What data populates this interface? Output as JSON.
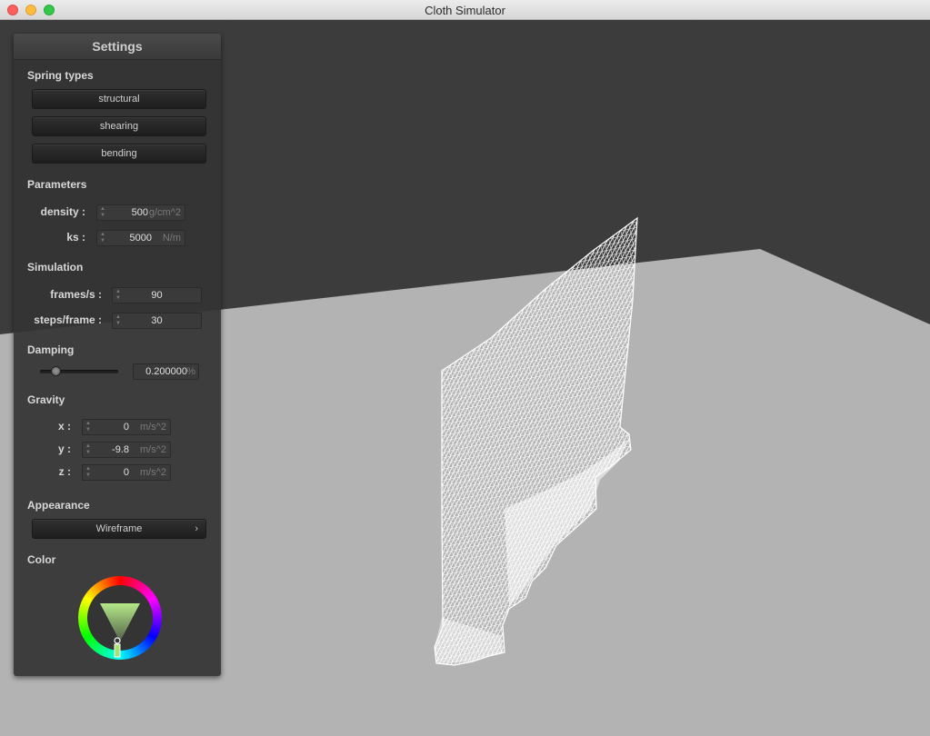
{
  "window": {
    "title": "Cloth Simulator"
  },
  "panel": {
    "title": "Settings",
    "spring_types": {
      "heading": "Spring types",
      "buttons": [
        "structural",
        "shearing",
        "bending"
      ]
    },
    "parameters": {
      "heading": "Parameters",
      "density": {
        "label": "density :",
        "value": "500",
        "unit": "g/cm^2"
      },
      "ks": {
        "label": "ks :",
        "value": "5000",
        "unit": "N/m"
      }
    },
    "simulation": {
      "heading": "Simulation",
      "fps": {
        "label": "frames/s :",
        "value": "90"
      },
      "steps": {
        "label": "steps/frame :",
        "value": "30"
      }
    },
    "damping": {
      "heading": "Damping",
      "slider_level": 0.2,
      "value": "0.200000",
      "unit": "%"
    },
    "gravity": {
      "heading": "Gravity",
      "x": {
        "label": "x :",
        "value": "0",
        "unit": "m/s^2"
      },
      "y": {
        "label": "y :",
        "value": "-9.8",
        "unit": "m/s^2"
      },
      "z": {
        "label": "z :",
        "value": "0",
        "unit": "m/s^2"
      }
    },
    "appearance": {
      "heading": "Appearance",
      "mode": "Wireframe"
    },
    "color": {
      "heading": "Color",
      "value": "#a4e36e"
    }
  },
  "scene": {
    "background_color": "#3c3c3c",
    "floor_color": "#b3b3b3",
    "cloth_color": "#ffffff"
  }
}
